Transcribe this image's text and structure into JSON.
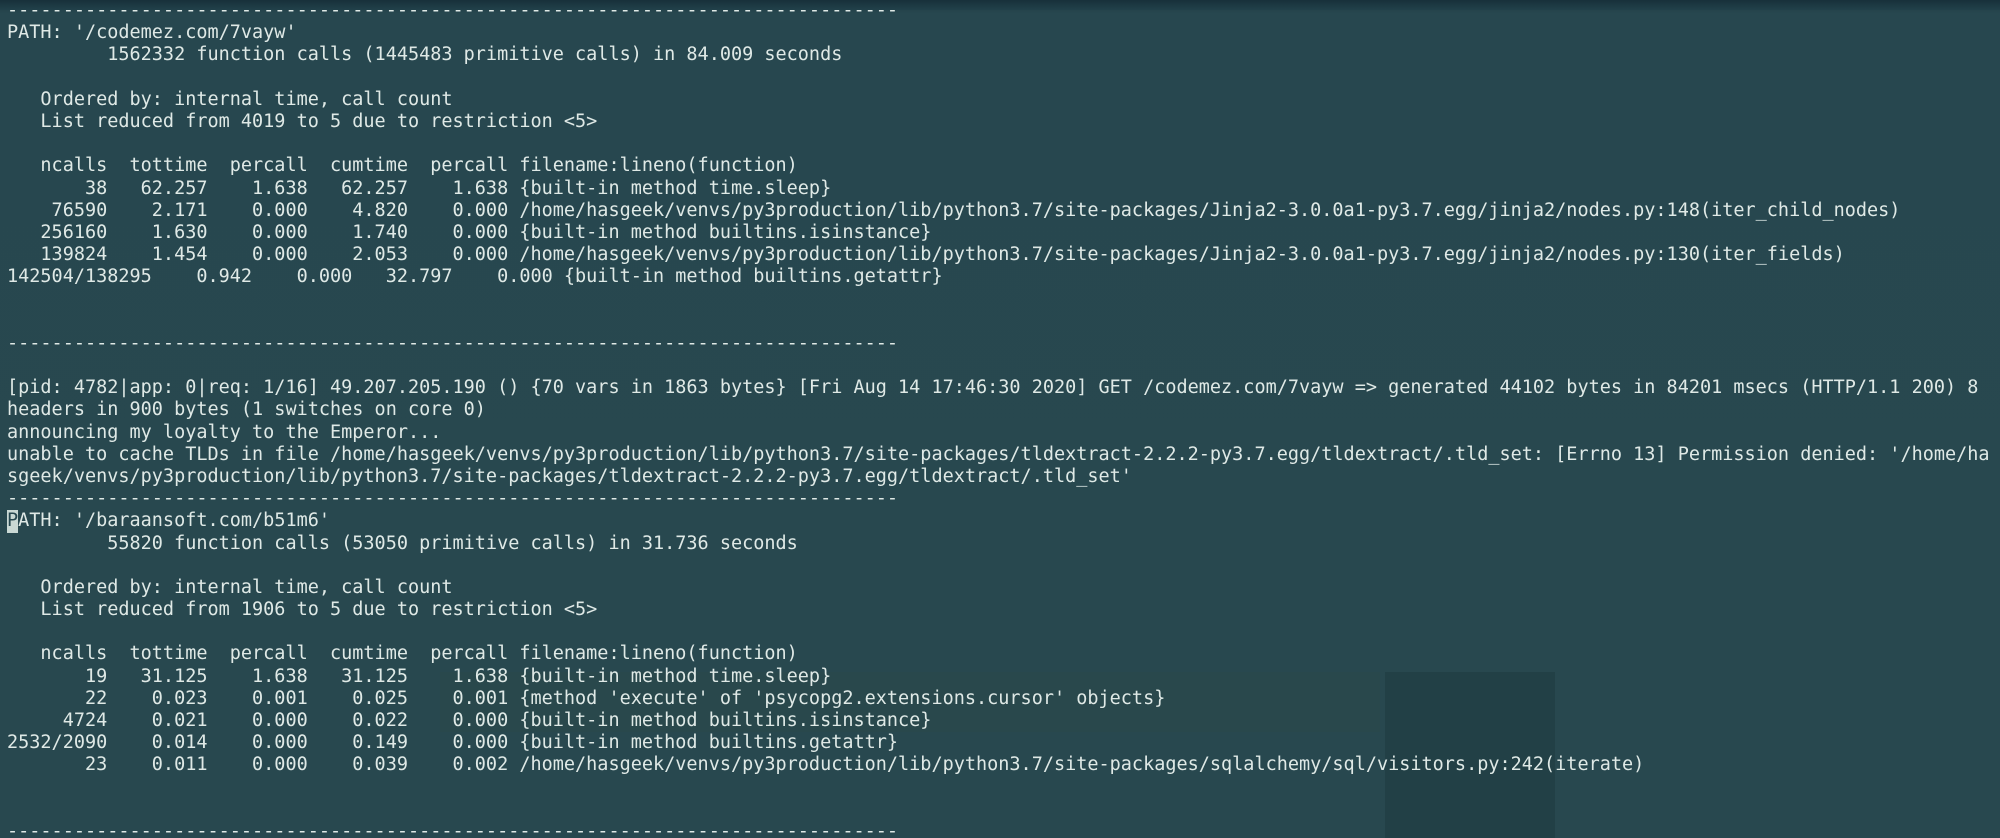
{
  "colors": {
    "background": "#27474f",
    "text": "#dfe9e6",
    "cursor": "#c9d8d4"
  },
  "terminal": {
    "lines": [
      "--------------------------------------------------------------------------------",
      "PATH: '/codemez.com/7vayw'",
      "         1562332 function calls (1445483 primitive calls) in 84.009 seconds",
      "",
      "   Ordered by: internal time, call count",
      "   List reduced from 4019 to 5 due to restriction <5>",
      "",
      "   ncalls  tottime  percall  cumtime  percall filename:lineno(function)",
      "       38   62.257    1.638   62.257    1.638 {built-in method time.sleep}",
      "    76590    2.171    0.000    4.820    0.000 /home/hasgeek/venvs/py3production/lib/python3.7/site-packages/Jinja2-3.0.0a1-py3.7.egg/jinja2/nodes.py:148(iter_child_nodes)",
      "   256160    1.630    0.000    1.740    0.000 {built-in method builtins.isinstance}",
      "   139824    1.454    0.000    2.053    0.000 /home/hasgeek/venvs/py3production/lib/python3.7/site-packages/Jinja2-3.0.0a1-py3.7.egg/jinja2/nodes.py:130(iter_fields)",
      "142504/138295    0.942    0.000   32.797    0.000 {built-in method builtins.getattr}",
      "",
      "",
      "--------------------------------------------------------------------------------",
      "",
      "[pid: 4782|app: 0|req: 1/16] 49.207.205.190 () {70 vars in 1863 bytes} [Fri Aug 14 17:46:30 2020] GET /codemez.com/7vayw => generated 44102 bytes in 84201 msecs (HTTP/1.1 200) 8",
      "headers in 900 bytes (1 switches on core 0)",
      "announcing my loyalty to the Emperor...",
      "unable to cache TLDs in file /home/hasgeek/venvs/py3production/lib/python3.7/site-packages/tldextract-2.2.2-py3.7.egg/tldextract/.tld_set: [Errno 13] Permission denied: '/home/ha",
      "sgeek/venvs/py3production/lib/python3.7/site-packages/tldextract-2.2.2-py3.7.egg/tldextract/.tld_set'",
      "--------------------------------------------------------------------------------"
    ],
    "cursor_char": "P",
    "cursor_line_rest": "ATH: '/baraansoft.com/b51m6'",
    "lines_after": [
      "         55820 function calls (53050 primitive calls) in 31.736 seconds",
      "",
      "   Ordered by: internal time, call count",
      "   List reduced from 1906 to 5 due to restriction <5>",
      "",
      "   ncalls  tottime  percall  cumtime  percall filename:lineno(function)",
      "       19   31.125    1.638   31.125    1.638 {built-in method time.sleep}",
      "       22    0.023    0.001    0.025    0.001 {method 'execute' of 'psycopg2.extensions.cursor' objects}",
      "     4724    0.021    0.000    0.022    0.000 {built-in method builtins.isinstance}",
      "2532/2090    0.014    0.000    0.149    0.000 {built-in method builtins.getattr}",
      "       23    0.011    0.000    0.039    0.002 /home/hasgeek/venvs/py3production/lib/python3.7/site-packages/sqlalchemy/sql/visitors.py:242(iterate)",
      "",
      "",
      "--------------------------------------------------------------------------------"
    ]
  }
}
